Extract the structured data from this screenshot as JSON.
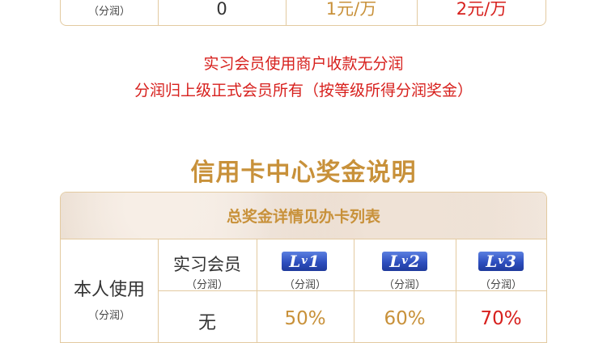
{
  "top_table": {
    "row_label_sub": "（分润）",
    "values": [
      "0",
      "1元/万",
      "2元/万"
    ]
  },
  "notes": {
    "line1": "实习会员使用商户收款无分润",
    "line2": "分润归上级正式会员所有（按等级所得分润奖金）"
  },
  "section_title": "信用卡中心奖金说明",
  "table": {
    "banner": "总奖金详情见办卡列表",
    "row_title": "本人使用",
    "row_sub": "（分润）",
    "columns": [
      {
        "label": "实习会员",
        "sub": "（分润）"
      },
      {
        "badge": "Lv1",
        "badge_main": "L",
        "badge_small": "v",
        "badge_num": "1",
        "sub": "（分润）"
      },
      {
        "badge": "Lv2",
        "badge_main": "L",
        "badge_small": "v",
        "badge_num": "2",
        "sub": "（分润）"
      },
      {
        "badge": "Lv3",
        "badge_main": "L",
        "badge_small": "v",
        "badge_num": "3",
        "sub": "（分润）"
      }
    ],
    "values": [
      "无",
      "50%",
      "60%",
      "70%"
    ]
  },
  "colors": {
    "gold": "#c8913a",
    "red": "#d7201d",
    "badge_blue": "#2e4fbf",
    "border": "#e3caa0"
  }
}
